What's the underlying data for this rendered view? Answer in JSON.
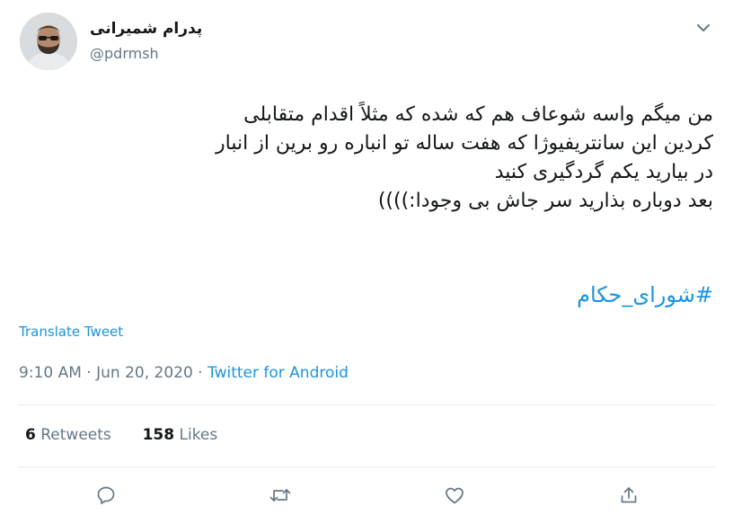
{
  "author": {
    "name": "پدرام شمیرانی",
    "handle": "@pdrmsh",
    "avatar_icon": "profile-photo"
  },
  "tweet": {
    "lines": [
      "من میگم واسه شوعاف هم که شده که مثلاً اقدام متقابلی",
      "کردین این سانتریفیوژا که هفت ساله تو انباره رو برین از انبار",
      "در بیارید یکم گردگیری کنید",
      "بعد دوباره بذارید سر جاش بی وجودا:))))"
    ],
    "hashtag": "#شورای_حکام"
  },
  "translate_label": "Translate Tweet",
  "meta": {
    "time": "9:10 AM",
    "sep1": " · ",
    "date": "Jun 20, 2020",
    "sep2": " · ",
    "source": "Twitter for Android"
  },
  "stats": {
    "retweets_count": "6",
    "retweets_label": "Retweets",
    "likes_count": "158",
    "likes_label": "Likes"
  },
  "actions": [
    "reply-icon",
    "retweet-icon",
    "like-icon",
    "share-icon"
  ],
  "colors": {
    "link": "#1b95e0",
    "secondary": "#657786",
    "primary": "#14171a",
    "divider": "#e6ecf0"
  }
}
